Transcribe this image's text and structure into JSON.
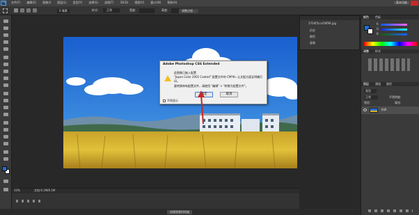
{
  "app": {
    "logo": "Ps"
  },
  "menubar": {
    "items": [
      "文件(F)",
      "编辑(E)",
      "图像(I)",
      "图层(L)",
      "类型(Y)",
      "选择(S)",
      "滤镜(T)",
      "3D(D)",
      "视图(V)",
      "窗口(W)",
      "帮助(H)"
    ],
    "workspace": "基本功能"
  },
  "options": {
    "feather_value": "0 像素",
    "style_label": "样式:",
    "style_value": "正常",
    "width_label": "宽度:",
    "height_label": "高度:",
    "refine_button": "调整边缘..."
  },
  "minipanel": {
    "file": "3704f5cce58f99.jpg",
    "items": [
      "历史",
      "颜色",
      "画笔"
    ]
  },
  "dialog": {
    "title": "Adobe Photoshop CS6 Extended",
    "line1": "此图像已嵌入配置",
    "line2": "\"Japan Color 2001 Coated\" 配置文件的 CMYK» 让文配方面证明确打",
    "line3": "印。",
    "line4": "要转换带有配置文件，请使用 \"编辑\" > \"转换为配置文件\"。",
    "ok": "确定",
    "cancel": "取消",
    "checkbox": "不再显示"
  },
  "status": {
    "zoom": "33%",
    "doc": "文档:6.1M/6.1M"
  },
  "timeline": {
    "button": "创建视频时间轴"
  },
  "panels": {
    "tab_color": "颜色",
    "tab_swatches": "色板",
    "r_label": "R",
    "g_label": "G",
    "b_label": "B",
    "tab_adjust": "调整",
    "tab_styles": "样式",
    "tab_layers": "图层",
    "tab_channels": "通道",
    "tab_paths": "路径",
    "kind_label": "类型",
    "blend_mode": "正常",
    "opacity_label": "不透明度:",
    "fill_label": "填充:",
    "lock_label": "锁定:",
    "layer_name": "背景"
  },
  "colors": {
    "sky": "#2a6fd0",
    "field": "#d9b52a",
    "arrow": "#c62828"
  }
}
